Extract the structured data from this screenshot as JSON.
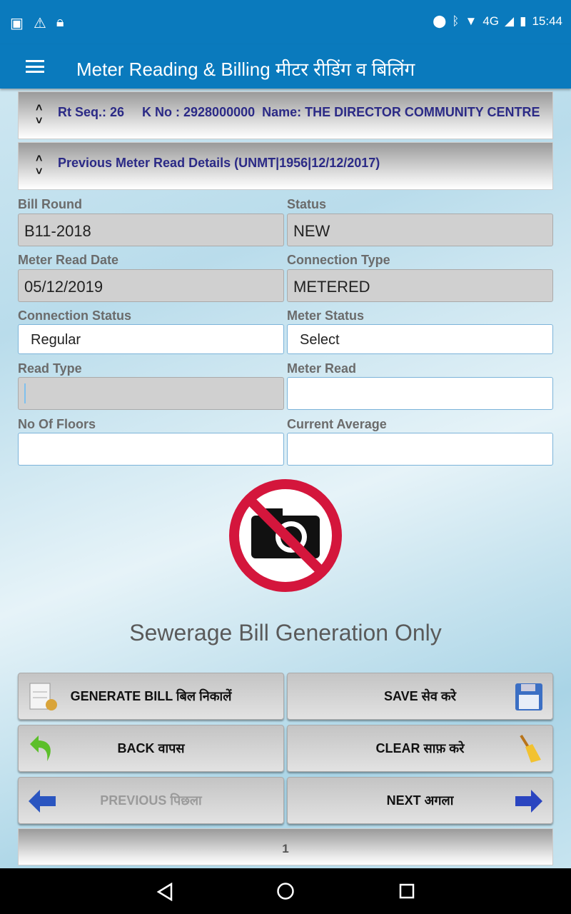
{
  "status_bar": {
    "time": "15:44",
    "network": "4G",
    "icons": [
      "image-icon",
      "warning-icon",
      "lock-icon",
      "location-icon",
      "bluetooth-icon",
      "wifi-icon",
      "signal-icon",
      "battery-icon"
    ]
  },
  "toolbar": {
    "title": "Meter Reading & Billing मीटर रीडिंग व बिलिंग"
  },
  "panels": [
    {
      "text": "Rt Seq.: 26     K No : 2928000000  Name: THE DIRECTOR COMMUNITY CENTRE"
    },
    {
      "text": "Previous Meter Read Details (UNMT|1956|12/12/2017)"
    }
  ],
  "form": {
    "bill_round": {
      "label": "Bill Round",
      "value": "B11-2018"
    },
    "status": {
      "label": "Status",
      "value": "NEW"
    },
    "meter_read_date": {
      "label": "Meter Read Date",
      "value": "05/12/2019"
    },
    "connection_type": {
      "label": "Connection Type",
      "value": "METERED"
    },
    "connection_status": {
      "label": "Connection Status",
      "value": "Regular"
    },
    "meter_status": {
      "label": "Meter Status",
      "value": "Select"
    },
    "read_type": {
      "label": "Read Type",
      "value": ""
    },
    "meter_read": {
      "label": "Meter Read",
      "value": ""
    },
    "no_of_floors": {
      "label": "No Of Floors",
      "value": ""
    },
    "current_average": {
      "label": "Current Average",
      "value": ""
    }
  },
  "message": "Sewerage Bill Generation Only",
  "buttons": {
    "generate": "GENERATE BILL बिल निकालें",
    "save": "SAVE सेव करे",
    "back": "BACK वापस",
    "clear": "CLEAR साफ़ करे",
    "previous": "PREVIOUS पिछला",
    "next": "NEXT अगला"
  },
  "page": "1",
  "colors": {
    "primary": "#0a7abd",
    "panel_text": "#2b2a86",
    "no_photo": "#d4163c"
  }
}
